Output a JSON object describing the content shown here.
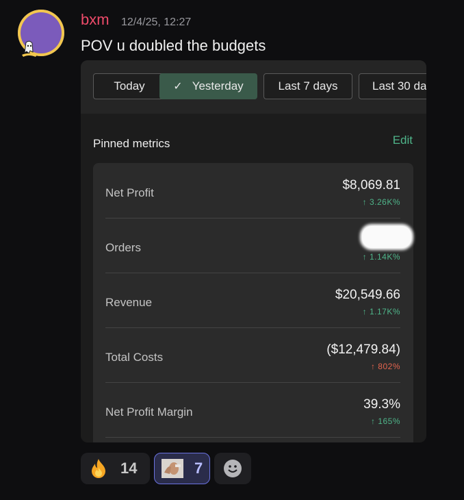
{
  "message": {
    "username": "bxm",
    "timestamp": "12/4/25, 12:27",
    "text": "POV u doubled the budgets"
  },
  "filters": [
    {
      "label": "Today",
      "selected": false
    },
    {
      "label": "Yesterday",
      "selected": true
    },
    {
      "label": "Last 7 days",
      "selected": false
    },
    {
      "label": "Last 30 da",
      "selected": false
    }
  ],
  "pinned": {
    "title": "Pinned metrics",
    "edit_label": "Edit",
    "metrics": [
      {
        "label": "Net Profit",
        "value": "$8,069.81",
        "delta": "↑ 3.26K%",
        "trend": "up"
      },
      {
        "label": "Orders",
        "value": "",
        "delta": "↑ 1.14K%",
        "trend": "up",
        "redacted": true
      },
      {
        "label": "Revenue",
        "value": "$20,549.66",
        "delta": "↑ 1.17K%",
        "trend": "up"
      },
      {
        "label": "Total Costs",
        "value": "($12,479.84)",
        "delta": "↑ 802%",
        "trend": "down"
      },
      {
        "label": "Net Profit Margin",
        "value": "39.3%",
        "delta": "↑ 165%",
        "trend": "up"
      }
    ]
  },
  "reactions": [
    {
      "emoji": "fire-emoji",
      "count": "14"
    },
    {
      "emoji": "custom-photo-emoji",
      "count": "7"
    },
    {
      "emoji": "add-reaction-icon",
      "count": ""
    }
  ],
  "colors": {
    "username": "#ee4b6a",
    "accent_green": "#4fb58a",
    "negative_red": "#e5644e",
    "selected_chip": "#3a5a4a"
  }
}
